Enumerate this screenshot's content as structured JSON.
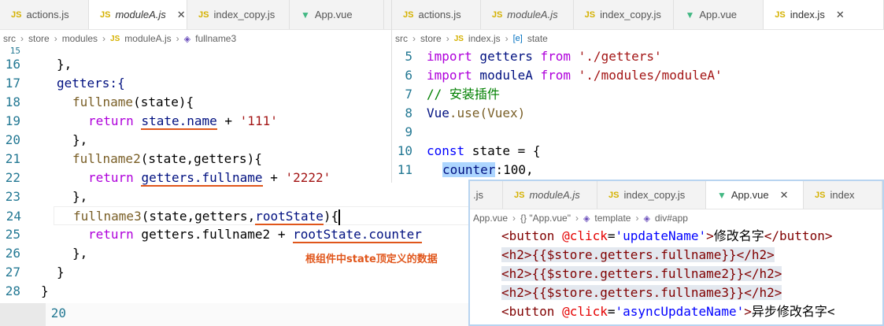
{
  "left": {
    "tabs": [
      {
        "label": "actions.js",
        "kind": "js",
        "active": false
      },
      {
        "label": "moduleA.js",
        "kind": "js",
        "active": true
      },
      {
        "label": "index_copy.js",
        "kind": "js",
        "active": false
      },
      {
        "label": "App.vue",
        "kind": "vue",
        "active": false
      }
    ],
    "js_badge": "JS",
    "close": "✕",
    "breadcrumb": [
      "src",
      "store",
      "modules",
      "moduleA.js",
      "fullname3"
    ],
    "annotation": "根组件中state顶定义的数据",
    "lines": [
      "16",
      "17",
      "18",
      "19",
      "20",
      "21",
      "22",
      "23",
      "24",
      "25",
      "26",
      "27",
      "28"
    ],
    "partial_top": "15",
    "extra_line": "20",
    "code": {
      "l16": "},",
      "l17": "getters:{",
      "l18a": "fullname",
      "l18b": "(state){",
      "l19a": "return",
      "l19b": "state.name",
      "l19c": " + ",
      "l19d": "'111'",
      "l20": "},",
      "l21a": "fullname2",
      "l21b": "(state,getters){",
      "l22a": "return",
      "l22b": "getters.fullname",
      "l22c": " + ",
      "l22d": "'2222'",
      "l23": "},",
      "l24a": "fullname3",
      "l24b": "(state,getters,",
      "l24c": "rootState",
      "l24d": "){",
      "l25a": "return",
      "l25b": " getters.fullname2 + ",
      "l25c": "rootState.counter",
      "l26": "},",
      "l27": "}",
      "l28": "}"
    }
  },
  "right": {
    "tabs": [
      {
        "label": "actions.js",
        "kind": "js",
        "active": false
      },
      {
        "label": "moduleA.js",
        "kind": "js",
        "active": false
      },
      {
        "label": "index_copy.js",
        "kind": "js",
        "active": false
      },
      {
        "label": "App.vue",
        "kind": "vue",
        "active": false
      },
      {
        "label": "index.js",
        "kind": "js",
        "active": true
      }
    ],
    "breadcrumb": [
      "src",
      "store",
      "index.js",
      "state"
    ],
    "lines": [
      "5",
      "6",
      "7",
      "8",
      "9",
      "10",
      "11"
    ],
    "code": {
      "l5a": "import",
      "l5b": " getters ",
      "l5c": "from",
      "l5d": " './getters'",
      "l6a": "import",
      "l6b": " moduleA ",
      "l6c": "from",
      "l6d": " './modules/moduleA'",
      "l7": "// 安装插件",
      "l8a": "Vue",
      "l8b": ".use(Vuex)",
      "l10a": "const",
      "l10b": " state = {",
      "l11a": "counter",
      "l11b": ":100,"
    }
  },
  "bottom": {
    "tabs": [
      {
        "label": ".js",
        "kind": "none",
        "active": false
      },
      {
        "label": "moduleA.js",
        "kind": "js",
        "active": false
      },
      {
        "label": "index_copy.js",
        "kind": "js",
        "active": false
      },
      {
        "label": "App.vue",
        "kind": "vue",
        "active": true
      },
      {
        "label": "index",
        "kind": "js",
        "active": false
      }
    ],
    "breadcrumb": [
      "App.vue",
      "{} \"App.vue\"",
      "template",
      "div#app"
    ],
    "code": {
      "b1a": "<button",
      "b1b": " @click",
      "b1c": "=",
      "b1d": "'updateName'",
      "b1e": ">",
      "b1f": "修改名字",
      "b1g": "</button>",
      "b2": "<h2>{{$store.getters.fullname}}</h2>",
      "b3": "<h2>{{$store.getters.fullname2}}</h2>",
      "b4": "<h2>{{$store.getters.fullname3}}</h2>",
      "b5a": "<button",
      "b5b": " @click",
      "b5c": "=",
      "b5d": "'asyncUpdateName'",
      "b5e": ">",
      "b5f": "异步修改名字<"
    }
  }
}
